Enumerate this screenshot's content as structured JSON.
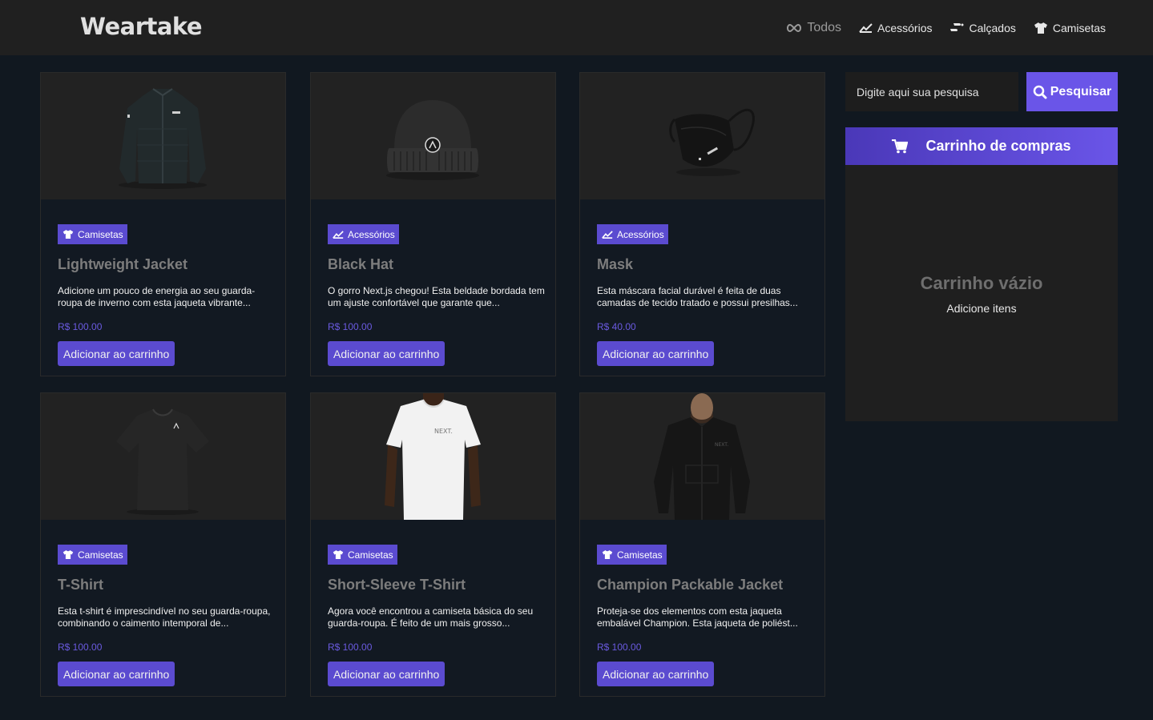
{
  "header": {
    "logo": "Weartake",
    "nav": [
      {
        "label": "Todos",
        "icon": "infinity-icon"
      },
      {
        "label": "Acessórios",
        "icon": "accessory-icon"
      },
      {
        "label": "Calçados",
        "icon": "shoe-icon"
      },
      {
        "label": "Camisetas",
        "icon": "tshirt-icon"
      }
    ]
  },
  "products": [
    {
      "category": "Camisetas",
      "title": "Lightweight Jacket",
      "desc": "Adicione um pouco de energia ao seu guarda-roupa de inverno com esta jaqueta vibrante...",
      "price": "R$ 100.00",
      "button": "Adicionar ao carrinho"
    },
    {
      "category": "Acessórios",
      "title": "Black Hat",
      "desc": "O gorro Next.js chegou! Esta beldade bordada tem um ajuste confortável que garante que...",
      "price": "R$ 100.00",
      "button": "Adicionar ao carrinho"
    },
    {
      "category": "Acessórios",
      "title": "Mask",
      "desc": "Esta máscara facial durável é feita de duas camadas de tecido tratado e possui presilhas...",
      "price": "R$ 40.00",
      "button": "Adicionar ao carrinho"
    },
    {
      "category": "Camisetas",
      "title": "T-Shirt",
      "desc": "Esta t-shirt é imprescindível no seu guarda-roupa, combinando o caimento intemporal de...",
      "price": "R$ 100.00",
      "button": "Adicionar ao carrinho"
    },
    {
      "category": "Camisetas",
      "title": "Short-Sleeve T-Shirt",
      "desc": "Agora você encontrou a camiseta básica do seu guarda-roupa. É feito de um mais grosso...",
      "price": "R$ 100.00",
      "button": "Adicionar ao carrinho"
    },
    {
      "category": "Camisetas",
      "title": "Champion Packable Jacket",
      "desc": "Proteja-se dos elementos com esta jaqueta embalável Champion. Esta jaqueta de poliést...",
      "price": "R$ 100.00",
      "button": "Adicionar ao carrinho"
    }
  ],
  "search": {
    "placeholder": "Digite aqui sua pesquisa",
    "button": "Pesquisar"
  },
  "cart": {
    "title": "Carrinho de compras",
    "empty_title": "Carrinho vázio",
    "empty_sub": "Adicione itens"
  },
  "colors": {
    "accent": "#5b4bd0",
    "background": "#111820",
    "header": "#202020"
  }
}
